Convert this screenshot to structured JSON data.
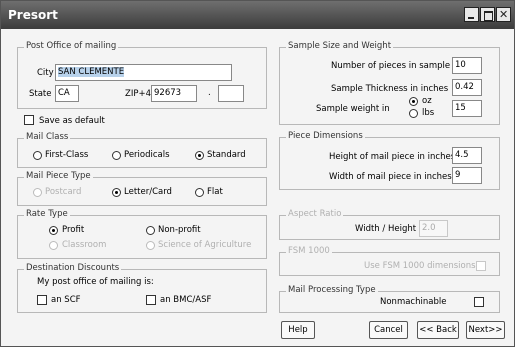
{
  "window": {
    "title": "Presort"
  },
  "post_office": {
    "legend": "Post Office of mailing",
    "city_label": "City",
    "city_value": "SAN CLEMENTE",
    "state_label": "State",
    "state_value": "CA",
    "zip_label": "ZIP+4",
    "zip_value": "92673",
    "zip_sep": ".",
    "zip4_value": ""
  },
  "save_default": {
    "label": "Save as default",
    "checked": false
  },
  "mail_class": {
    "legend": "Mail Class",
    "options": [
      "First-Class",
      "Periodicals",
      "Standard"
    ],
    "selected": "Standard"
  },
  "piece_type": {
    "legend": "Mail Piece Type",
    "options": [
      "Postcard",
      "Letter/Card",
      "Flat"
    ],
    "selected": "Letter/Card"
  },
  "rate_type": {
    "legend": "Rate Type",
    "options": [
      "Profit",
      "Non-profit",
      "Classroom",
      "Science of Agriculture"
    ],
    "selected": "Profit"
  },
  "destination": {
    "legend": "Destination Discounts",
    "prompt": "My post office of mailing is:",
    "scf_label": "an SCF",
    "bmc_label": "an BMC/ASF"
  },
  "sample": {
    "legend": "Sample Size and Weight",
    "count_label": "Number of pieces in sample",
    "count_value": "10",
    "thickness_label": "Sample Thickness in inches",
    "thickness_value": "0.42",
    "weight_label": "Sample weight in",
    "unit_oz": "oz",
    "unit_lbs": "lbs",
    "unit_selected": "oz",
    "weight_value": "15"
  },
  "dimensions": {
    "legend": "Piece Dimensions",
    "height_label": "Height of mail piece in inches",
    "height_value": "4.5",
    "width_label": "Width of mail piece in inches",
    "width_value": "9"
  },
  "aspect": {
    "legend": "Aspect Ratio",
    "label": "Width / Height",
    "value": "2.0"
  },
  "fsm": {
    "legend": "FSM 1000",
    "label": "Use FSM 1000 dimensions"
  },
  "processing": {
    "legend": "Mail Processing Type",
    "label": "Nonmachinable"
  },
  "buttons": {
    "help": "Help",
    "cancel": "Cancel",
    "back": "<< Back",
    "next": "Next>>"
  }
}
